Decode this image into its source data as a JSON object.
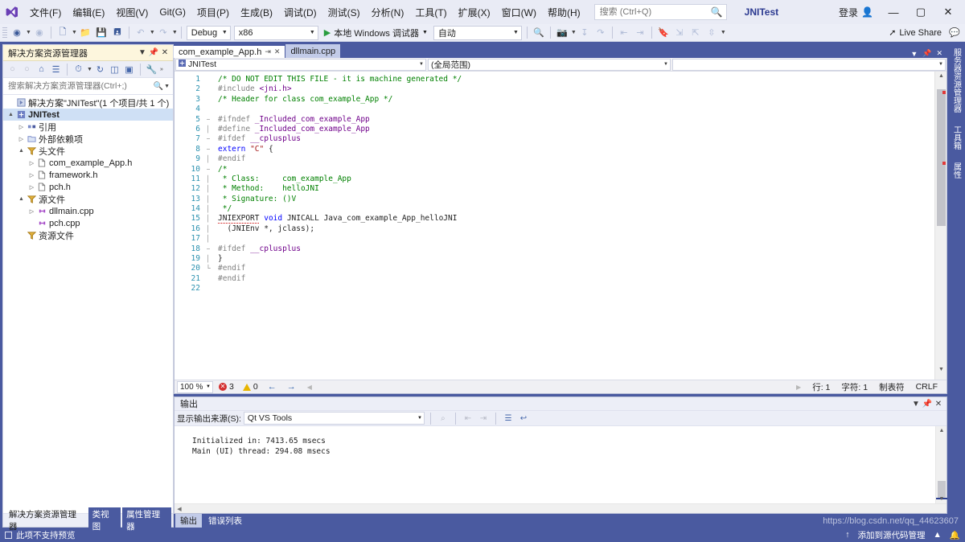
{
  "window": {
    "solution_name": "JNITest",
    "signin_label": "登录",
    "minimize": "—",
    "maximize": "▢",
    "close": "✕"
  },
  "menubar": {
    "items": [
      {
        "label": "文件(F)"
      },
      {
        "label": "编辑(E)"
      },
      {
        "label": "视图(V)"
      },
      {
        "label": "Git(G)"
      },
      {
        "label": "项目(P)"
      },
      {
        "label": "生成(B)"
      },
      {
        "label": "调试(D)"
      },
      {
        "label": "测试(S)"
      },
      {
        "label": "分析(N)"
      },
      {
        "label": "工具(T)"
      },
      {
        "label": "扩展(X)"
      },
      {
        "label": "窗口(W)"
      },
      {
        "label": "帮助(H)"
      }
    ]
  },
  "search": {
    "placeholder": "搜索 (Ctrl+Q)",
    "value": ""
  },
  "toolbar": {
    "config": "Debug",
    "platform": "x86",
    "run_label": "本地 Windows 调试器",
    "auto": "自动",
    "live_share": "Live Share"
  },
  "solution_explorer": {
    "title": "解决方案资源管理器",
    "search_placeholder": "搜索解决方案资源管理器(Ctrl+;)",
    "root": "解决方案\"JNITest\"(1 个项目/共 1 个)",
    "tree": [
      {
        "label": "JNITest",
        "depth": 1,
        "arrow": "▲",
        "icon": "project-icon",
        "bold": true,
        "selected": true
      },
      {
        "label": "引用",
        "depth": 2,
        "arrow": "▷",
        "icon": "references-icon",
        "bold": false,
        "selected": false
      },
      {
        "label": "外部依赖项",
        "depth": 2,
        "arrow": "▷",
        "icon": "folder-icon",
        "bold": false,
        "selected": false
      },
      {
        "label": "头文件",
        "depth": 2,
        "arrow": "▲",
        "icon": "filter-icon",
        "bold": false,
        "selected": false
      },
      {
        "label": "com_example_App.h",
        "depth": 3,
        "arrow": "▷",
        "icon": "file-h-icon",
        "bold": false,
        "selected": false
      },
      {
        "label": "framework.h",
        "depth": 3,
        "arrow": "▷",
        "icon": "file-h-icon",
        "bold": false,
        "selected": false
      },
      {
        "label": "pch.h",
        "depth": 3,
        "arrow": "▷",
        "icon": "file-h-icon",
        "bold": false,
        "selected": false
      },
      {
        "label": "源文件",
        "depth": 2,
        "arrow": "▲",
        "icon": "filter-icon",
        "bold": false,
        "selected": false
      },
      {
        "label": "dllmain.cpp",
        "depth": 3,
        "arrow": "▷",
        "icon": "file-cpp-icon",
        "bold": false,
        "selected": false
      },
      {
        "label": "pch.cpp",
        "depth": 3,
        "arrow": "",
        "icon": "file-cpp-icon",
        "bold": false,
        "selected": false
      },
      {
        "label": "资源文件",
        "depth": 2,
        "arrow": "",
        "icon": "filter-icon",
        "bold": false,
        "selected": false
      }
    ],
    "bottom_tabs": [
      {
        "label": "解决方案资源管理器",
        "active": false
      },
      {
        "label": "类视图",
        "active": true
      },
      {
        "label": "属性管理器",
        "active": true
      }
    ]
  },
  "editor": {
    "tabs": [
      {
        "label": "com_example_App.h",
        "active": true,
        "pin": "⇥",
        "close": "✕"
      },
      {
        "label": "dllmain.cpp",
        "active": false,
        "pin": "",
        "close": ""
      }
    ],
    "nav_project": "JNITest",
    "nav_scope": "(全局范围)",
    "nav_member": "",
    "lines": [
      {
        "n": 1,
        "fold": "",
        "text": "/* DO NOT EDIT THIS FILE - it is machine generated */",
        "cls": "cmt"
      },
      {
        "n": 2,
        "fold": "",
        "text": "#include <jni.h>",
        "cls": "pp"
      },
      {
        "n": 3,
        "fold": "",
        "text": "/* Header for class com_example_App */",
        "cls": "cmt"
      },
      {
        "n": 4,
        "fold": "",
        "text": "",
        "cls": ""
      },
      {
        "n": 5,
        "fold": "−",
        "text": "#ifndef _Included_com_example_App",
        "cls": "pp"
      },
      {
        "n": 6,
        "fold": "│",
        "text": "#define _Included_com_example_App",
        "cls": "pp"
      },
      {
        "n": 7,
        "fold": "−",
        "text": "#ifdef __cplusplus",
        "cls": "pp"
      },
      {
        "n": 8,
        "fold": "−",
        "text": "extern \"C\" {",
        "cls": "kw"
      },
      {
        "n": 9,
        "fold": "│",
        "text": "#endif",
        "cls": "pp"
      },
      {
        "n": 10,
        "fold": "−",
        "text": "/*",
        "cls": "cmt"
      },
      {
        "n": 11,
        "fold": "│",
        "text": " * Class:     com_example_App",
        "cls": "cmt"
      },
      {
        "n": 12,
        "fold": "│",
        "text": " * Method:    helloJNI",
        "cls": "cmt"
      },
      {
        "n": 13,
        "fold": "│",
        "text": " * Signature: ()V",
        "cls": "cmt"
      },
      {
        "n": 14,
        "fold": "│",
        "text": " */",
        "cls": "cmt"
      },
      {
        "n": 15,
        "fold": "│",
        "text": "JNIEXPORT void JNICALL Java_com_example_App_helloJNI",
        "cls": ""
      },
      {
        "n": 16,
        "fold": "│",
        "text": "  (JNIEnv *, jclass);",
        "cls": ""
      },
      {
        "n": 17,
        "fold": "│",
        "text": "",
        "cls": ""
      },
      {
        "n": 18,
        "fold": "−",
        "text": "#ifdef __cplusplus",
        "cls": "pp"
      },
      {
        "n": 19,
        "fold": "│",
        "text": "}",
        "cls": ""
      },
      {
        "n": 20,
        "fold": "└",
        "text": "#endif",
        "cls": "pp"
      },
      {
        "n": 21,
        "fold": "",
        "text": "#endif",
        "cls": "pp"
      },
      {
        "n": 22,
        "fold": "",
        "text": "",
        "cls": ""
      }
    ],
    "status": {
      "zoom": "100 %",
      "error_count": "3",
      "warning_count": "0",
      "back": "←",
      "forward": "→",
      "line": "行: 1",
      "col": "字符: 1",
      "tabs_mode": "制表符",
      "eol": "CRLF"
    }
  },
  "output": {
    "title": "输出",
    "source_label": "显示输出来源(S):",
    "source_value": "Qt VS Tools",
    "lines": [
      "Initialized in: 7413.65 msecs",
      "Main (UI) thread: 294.08 msecs"
    ],
    "tabs": [
      {
        "label": "输出",
        "active": false
      },
      {
        "label": "错误列表",
        "active": true
      }
    ]
  },
  "right_strip": {
    "tabs": [
      "服务器资源管理器",
      "工具箱",
      "属性"
    ]
  },
  "statusbar": {
    "message": "此项不支持预览",
    "source_control": "添加到源代码管理",
    "up_arrow": "↑",
    "bell": "🔔"
  },
  "watermark": "https://blog.csdn.net/qq_44623607",
  "colors": {
    "accent": "#4a5aa0",
    "title_panel": "#fdf6dd",
    "comment": "#008000",
    "preprocessor": "#808080",
    "keyword": "#0000ff",
    "error": "#d32f2f",
    "warning": "#e8b500",
    "line_number": "#2b91af"
  }
}
